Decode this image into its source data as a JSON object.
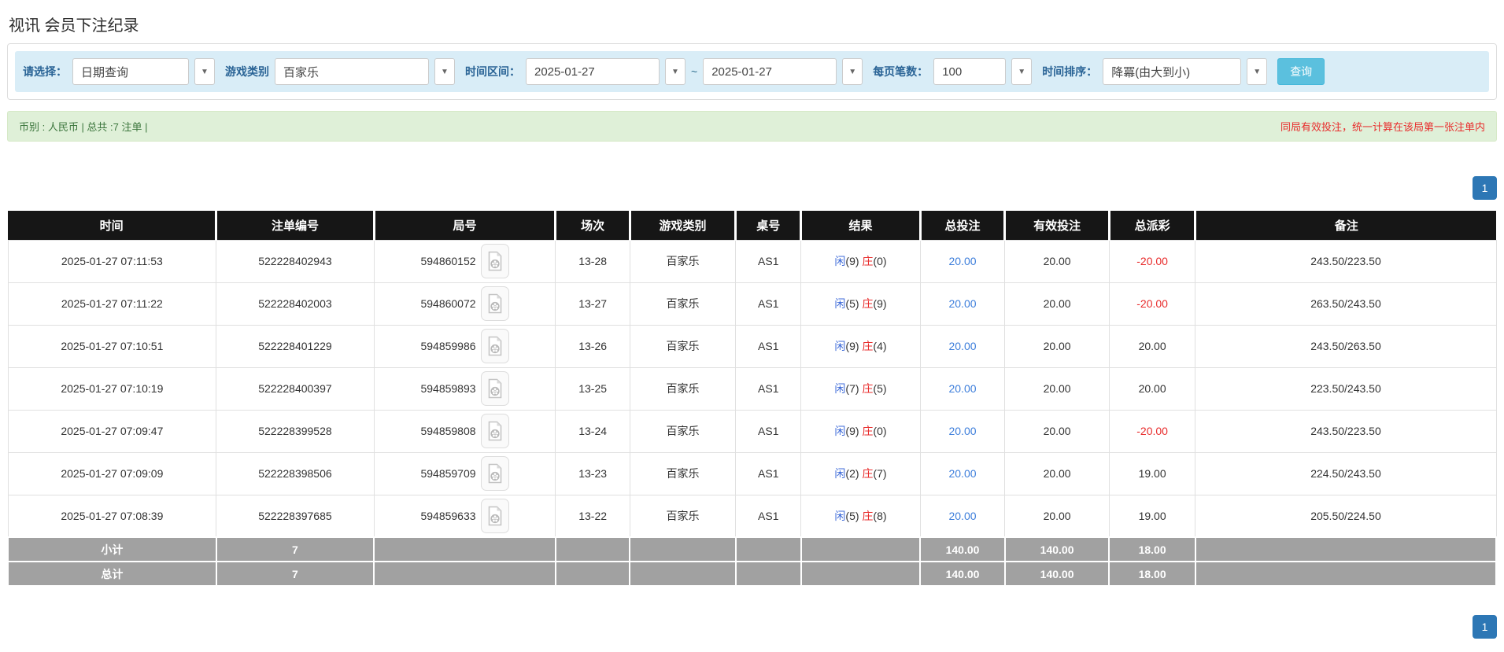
{
  "page": {
    "title": "视讯 会员下注纪录"
  },
  "filters": {
    "mode_label": "请选择：",
    "mode_value": "日期查询",
    "game_label": "游戏类别",
    "game_value": "百家乐",
    "range_label": "时间区间：",
    "date_from": "2025-01-27",
    "range_separator": "~",
    "date_to": "2025-01-27",
    "pagesize_label": "每页笔数：",
    "pagesize_value": "100",
    "sort_label": "时间排序：",
    "sort_value": "降冪(由大到小)",
    "search_button": "查询"
  },
  "summary": {
    "left_text": "币别 : 人民币 | 总共 :7 注单 |",
    "right_text": "同局有效投注，统一计算在该局第一张注单内"
  },
  "pagination": {
    "page": "1"
  },
  "table": {
    "headers": [
      "时间",
      "注单编号",
      "局号",
      "场次",
      "游戏类别",
      "桌号",
      "结果",
      "总投注",
      "有效投注",
      "总派彩",
      "备注"
    ],
    "result_labels": {
      "player": "闲",
      "banker": "庄"
    },
    "video_icon_name": "video-replay-icon",
    "rows": [
      {
        "time": "2025-01-27 07:11:53",
        "bet_no": "522228402943",
        "round_no": "594860152",
        "session": "13-28",
        "game": "百家乐",
        "table_no": "AS1",
        "player": "9",
        "banker": "0",
        "total_bet": "20.00",
        "valid_bet": "20.00",
        "payout": "-20.00",
        "remark": "243.50/223.50"
      },
      {
        "time": "2025-01-27 07:11:22",
        "bet_no": "522228402003",
        "round_no": "594860072",
        "session": "13-27",
        "game": "百家乐",
        "table_no": "AS1",
        "player": "5",
        "banker": "9",
        "total_bet": "20.00",
        "valid_bet": "20.00",
        "payout": "-20.00",
        "remark": "263.50/243.50"
      },
      {
        "time": "2025-01-27 07:10:51",
        "bet_no": "522228401229",
        "round_no": "594859986",
        "session": "13-26",
        "game": "百家乐",
        "table_no": "AS1",
        "player": "9",
        "banker": "4",
        "total_bet": "20.00",
        "valid_bet": "20.00",
        "payout": "20.00",
        "remark": "243.50/263.50"
      },
      {
        "time": "2025-01-27 07:10:19",
        "bet_no": "522228400397",
        "round_no": "594859893",
        "session": "13-25",
        "game": "百家乐",
        "table_no": "AS1",
        "player": "7",
        "banker": "5",
        "total_bet": "20.00",
        "valid_bet": "20.00",
        "payout": "20.00",
        "remark": "223.50/243.50"
      },
      {
        "time": "2025-01-27 07:09:47",
        "bet_no": "522228399528",
        "round_no": "594859808",
        "session": "13-24",
        "game": "百家乐",
        "table_no": "AS1",
        "player": "9",
        "banker": "0",
        "total_bet": "20.00",
        "valid_bet": "20.00",
        "payout": "-20.00",
        "remark": "243.50/223.50"
      },
      {
        "time": "2025-01-27 07:09:09",
        "bet_no": "522228398506",
        "round_no": "594859709",
        "session": "13-23",
        "game": "百家乐",
        "table_no": "AS1",
        "player": "2",
        "banker": "7",
        "total_bet": "20.00",
        "valid_bet": "20.00",
        "payout": "19.00",
        "remark": "224.50/243.50"
      },
      {
        "time": "2025-01-27 07:08:39",
        "bet_no": "522228397685",
        "round_no": "594859633",
        "session": "13-22",
        "game": "百家乐",
        "table_no": "AS1",
        "player": "5",
        "banker": "8",
        "total_bet": "20.00",
        "valid_bet": "20.00",
        "payout": "19.00",
        "remark": "205.50/224.50"
      }
    ],
    "footer_rows": [
      {
        "label": "小计",
        "count": "7",
        "total_bet": "140.00",
        "valid_bet": "140.00",
        "payout": "18.00"
      },
      {
        "label": "总计",
        "count": "7",
        "total_bet": "140.00",
        "valid_bet": "140.00",
        "payout": "18.00"
      }
    ]
  },
  "colors": {
    "header_bg": "#161616",
    "accent_blue": "#2d77b5",
    "link_blue": "#3d7edb",
    "player_blue": "#3d6ad8",
    "banker_red": "#e82c2c",
    "negative_red": "#e82c2c",
    "search_btn": "#5bc0de",
    "filter_bg": "#d9edf7",
    "label_blue": "#2a6496",
    "success_bg": "#dff0d8",
    "success_text": "#3c763d",
    "warn_red": "#e82c2c",
    "footer_bg": "#a1a1a1"
  }
}
